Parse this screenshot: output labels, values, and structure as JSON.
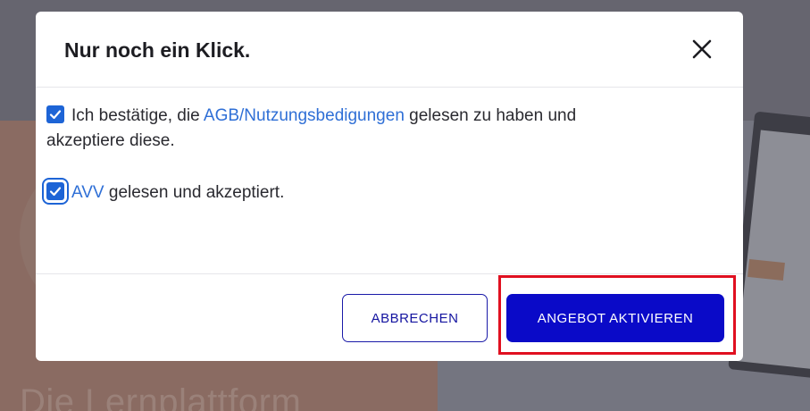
{
  "background": {
    "headline": "Die Lernplattform"
  },
  "modal": {
    "title": "Nur noch ein Klick.",
    "close_icon": "close-icon",
    "terms": {
      "checked": true,
      "text_before": "Ich bestätige, die ",
      "link": "AGB/Nutzungsbedigungen",
      "text_after": " gelesen zu haben und akzeptiere diese."
    },
    "avv": {
      "checked": true,
      "link": "AVV",
      "text_after": " gelesen und akzeptiert."
    },
    "cancel_label": "ABBRECHEN",
    "confirm_label": "ANGEBOT AKTIVIEREN"
  },
  "colors": {
    "primary": "#0a0ac8",
    "link": "#2f6fd6",
    "checkbox": "#1d64d6",
    "highlight": "#e01020"
  }
}
